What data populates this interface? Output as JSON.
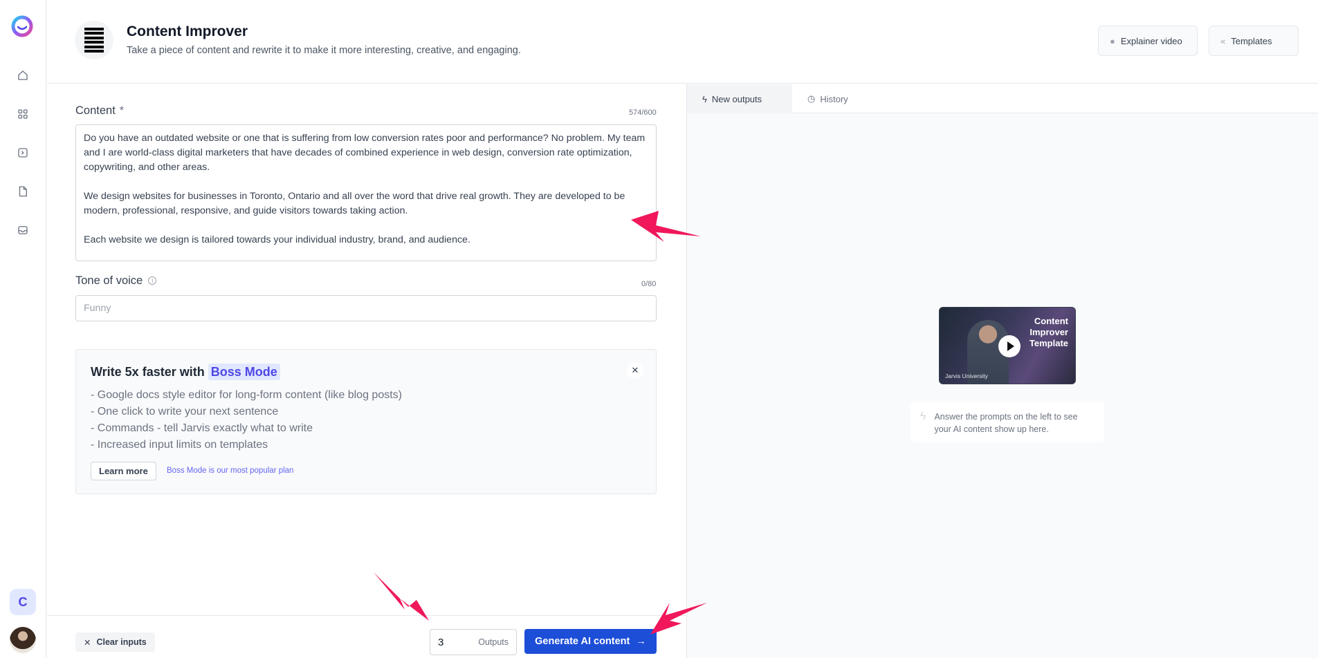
{
  "sidebar": {
    "items": [
      {
        "name": "home-icon"
      },
      {
        "name": "templates-grid-icon"
      },
      {
        "name": "terminal-icon"
      },
      {
        "name": "document-icon"
      },
      {
        "name": "inbox-icon"
      }
    ],
    "user_initial": "C"
  },
  "header": {
    "title": "Content Improver",
    "subtitle": "Take a piece of content and rewrite it to make it more interesting, creative, and engaging.",
    "explainer_label": "Explainer video",
    "templates_label": "Templates"
  },
  "form": {
    "content_label": "Content",
    "required_mark": "*",
    "content_counter": "574/600",
    "content_paragraphs": [
      "Do you have an outdated website or one that is suffering from low conversion rates poor and performance? No problem. My team and I are world-class digital marketers that have decades of combined experience in web design, conversion rate optimization, copywriting, and other areas.",
      "We design websites for businesses in Toronto, Ontario and all over the word that drive real growth. They are developed to be modern, professional, responsive, and guide visitors towards taking action.",
      "Each website we design is tailored towards your individual industry, brand, and audience."
    ],
    "tone_label": "Tone of voice",
    "tone_counter": "0/80",
    "tone_placeholder": "Funny"
  },
  "boss": {
    "title_prefix": "Write 5x faster with",
    "title_highlight": "Boss Mode",
    "features": [
      "- Google docs style editor for long-form content (like blog posts)",
      "- One click to write your next sentence",
      "- Commands - tell Jarvis exactly what to write",
      "- Increased input limits on templates"
    ],
    "learn_more": "Learn more",
    "note": "Boss Mode is our most popular plan"
  },
  "footer": {
    "clear_label": "Clear inputs",
    "outputs_value": "3",
    "outputs_label": "Outputs",
    "generate_label": "Generate AI content"
  },
  "output_panel": {
    "tab_new": "New outputs",
    "tab_history": "History",
    "video_title_lines": [
      "Content",
      "Improver",
      "Template"
    ],
    "video_brand": "Jarvis University",
    "hint": "Answer the prompts on the left to see your AI content show up here."
  },
  "colors": {
    "accent": "#1d4ed8",
    "boss_highlight": "#4f46e5",
    "annotation_arrow": "#f0185a"
  }
}
